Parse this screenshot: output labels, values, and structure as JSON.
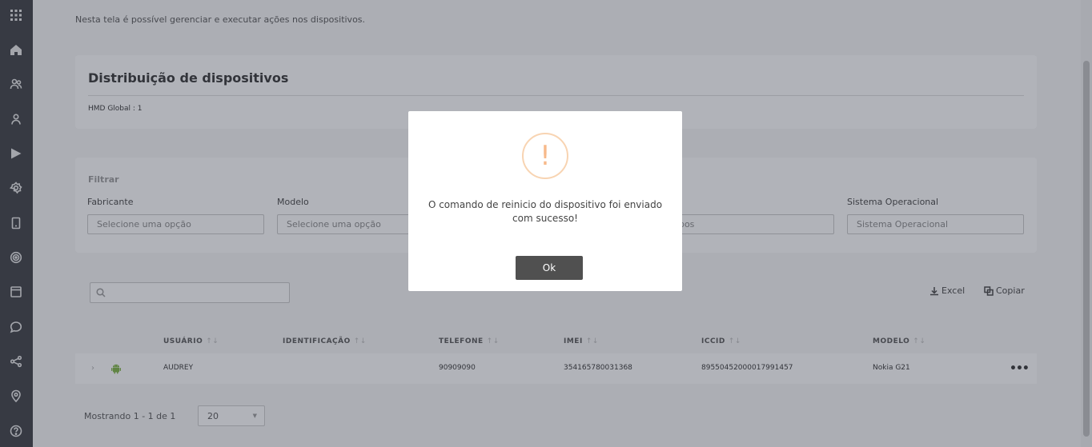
{
  "sidebar": {
    "icons": [
      "apps-grid-icon",
      "home-icon",
      "users-icon",
      "user-icon",
      "play-icon",
      "settings-icon",
      "device-icon",
      "target-icon",
      "window-icon",
      "chat-icon",
      "share-icon",
      "location-icon",
      "help-icon"
    ]
  },
  "intro": "Nesta tela é possível gerenciar e executar ações nos dispositivos.",
  "distribution": {
    "title": "Distribuição de dispositivos",
    "item": "HMD Global : 1"
  },
  "filter": {
    "title": "Filtrar",
    "fabricante_label": "Fabricante",
    "fabricante_placeholder": "Selecione uma opção",
    "modelo_label": "Modelo",
    "modelo_placeholder": "Selecione uma opção",
    "grupos_label_partial": "s",
    "grupos_placeholder_partial": "upos",
    "so_label": "Sistema Operacional",
    "so_placeholder": "Sistema Operacional"
  },
  "toolbar": {
    "excel_label": "Excel",
    "copy_label": "Copiar"
  },
  "table": {
    "headers": {
      "usuario": "USUÁRIO",
      "identificacao": "IDENTIFICAÇÃO",
      "telefone": "TELEFONE",
      "imei": "IMEI",
      "iccid": "ICCID",
      "modelo": "MODELO"
    },
    "rows": [
      {
        "usuario": "AUDREY",
        "identificacao": "",
        "telefone": "90909090",
        "imei": "354165780031368",
        "iccid": "89550452000017991457",
        "modelo": "Nokia G21"
      }
    ]
  },
  "pager": {
    "text": "Mostrando 1 - 1 de 1",
    "page_size": "20"
  },
  "modal": {
    "icon": "!",
    "message": "O comando de reinicio do dispositivo foi enviado com sucesso!",
    "ok_label": "Ok"
  },
  "colors": {
    "sidebar": "#3a3d42",
    "warning": "#f7b98a",
    "ok_button": "#505050"
  }
}
